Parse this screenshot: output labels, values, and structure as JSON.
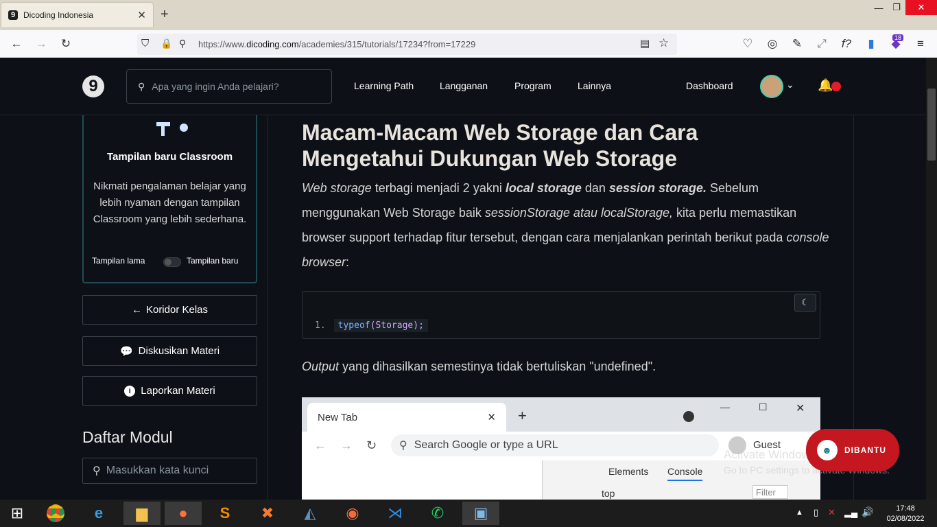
{
  "browser": {
    "tab_title": "Dicoding Indonesia",
    "tab_favicon": "9",
    "url_prefix": "https://www.",
    "url_domain": "dicoding.com",
    "url_path": "/academies/315/tutorials/17234?from=17229",
    "badge_count": "18"
  },
  "site": {
    "logo": "9",
    "search_placeholder": "Apa yang ingin Anda pelajari?",
    "menu": [
      "Learning Path",
      "Langganan",
      "Program",
      "Lainnya"
    ],
    "dashboard": "Dashboard"
  },
  "sidebar": {
    "card_title": "Tampilan baru Classroom",
    "card_desc": "Nikmati pengalaman belajar yang lebih nyaman dengan tampilan Classroom yang lebih sederhana.",
    "toggle_left": "Tampilan lama",
    "toggle_right": "Tampilan baru",
    "btn_koridor": "Koridor Kelas",
    "btn_diskusi": "Diskusikan Materi",
    "btn_lapor": "Laporkan Materi",
    "modul_title": "Daftar Modul",
    "modul_search_placeholder": "Masukkan kata kunci"
  },
  "article": {
    "title": "Macam-Macam Web Storage dan Cara Mengetahui Dukungan Web Storage",
    "p1_a": "Web storage",
    "p1_b": " terbagi menjadi 2 yakni ",
    "p1_c": "local storage",
    "p1_d": " dan ",
    "p1_e": "session storage.",
    "p1_f": " Sebelum menggunakan Web Storage baik ",
    "p1_g": "sessionStorage atau localStorage,",
    "p1_h": " kita perlu memastikan browser support terhadap fitur tersebut, dengan cara menjalankan perintah berikut pada ",
    "p1_i": "console browser",
    "p1_j": ":",
    "code_line_num": "1.",
    "code_kw": "typeof",
    "code_arg": "(Storage);",
    "output_a": "Output",
    "output_b": " yang dihasilkan semestinya tidak bertuliskan \"undefined\"."
  },
  "embedded": {
    "tab": "New Tab",
    "omnibox": "Search Google or type a URL",
    "guest": "Guest",
    "dev_elements": "Elements",
    "dev_console": "Console",
    "dev_top": "top",
    "dev_filter": "Filter"
  },
  "overlay": {
    "dibantu": "DIBANTU",
    "activate1": "Activate Windows",
    "activate2": "Go to PC settings to activate Windows."
  },
  "taskbar": {
    "time": "17:48",
    "date": "02/08/2022"
  }
}
